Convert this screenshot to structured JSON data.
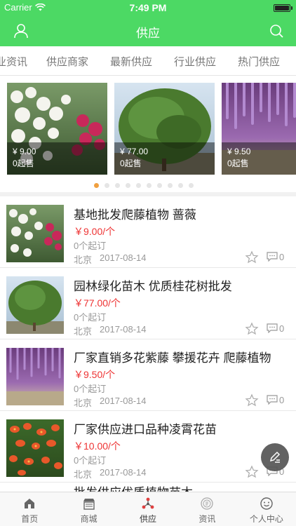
{
  "status_bar": {
    "carrier": "Carrier",
    "time": "7:49 PM"
  },
  "header": {
    "title": "供应",
    "left_icon": "user-icon",
    "right_icon": "search-icon"
  },
  "tabs": [
    {
      "label": "业资讯"
    },
    {
      "label": "供应商家"
    },
    {
      "label": "最新供应"
    },
    {
      "label": "行业供应"
    },
    {
      "label": "热门供应"
    }
  ],
  "carousel": {
    "cards": [
      {
        "price": "¥ 9.00",
        "moq": "0起售",
        "image": "white-rose-vines"
      },
      {
        "price": "¥ 77.00",
        "moq": "0起售",
        "image": "osmanthus-tree"
      },
      {
        "price": "¥ 9.50",
        "moq": "0起售",
        "image": "wisteria-tunnel"
      }
    ],
    "page_count": 10,
    "active_page": 0
  },
  "list": [
    {
      "name": "基地批发爬藤植物 蔷薇",
      "price": "￥9.00/个",
      "moq": "0个起订",
      "location": "北京",
      "date": "2017-08-14",
      "comments": "0",
      "image": "white-rose-vines"
    },
    {
      "name": "园林绿化苗木 优质桂花树批发",
      "price": "￥77.00/个",
      "moq": "0个起订",
      "location": "北京",
      "date": "2017-08-14",
      "comments": "0",
      "image": "osmanthus-tree"
    },
    {
      "name": "厂家直销多花紫藤 攀援花卉 爬藤植物",
      "price": "￥9.50/个",
      "moq": "0个起订",
      "location": "北京",
      "date": "2017-08-14",
      "comments": "0",
      "image": "wisteria-tunnel"
    },
    {
      "name": "厂家供应进口品种凌霄花苗",
      "price": "￥10.00/个",
      "moq": "0个起订",
      "location": "北京",
      "date": "2017-08-14",
      "comments": "0",
      "image": "trumpet-vine-flowers"
    }
  ],
  "partial_row_text": "批发供应优质植物苗木",
  "fab_icon": "edit-icon",
  "bottom_nav": [
    {
      "label": "首页",
      "icon": "home-icon"
    },
    {
      "label": "商城",
      "icon": "store-icon"
    },
    {
      "label": "供应",
      "icon": "supply-icon",
      "active": true
    },
    {
      "label": "资讯",
      "icon": "news-icon"
    },
    {
      "label": "个人中心",
      "icon": "profile-icon"
    }
  ],
  "colors": {
    "accent": "#4cd964",
    "price": "#e33333",
    "active_dot": "#f0a040"
  }
}
